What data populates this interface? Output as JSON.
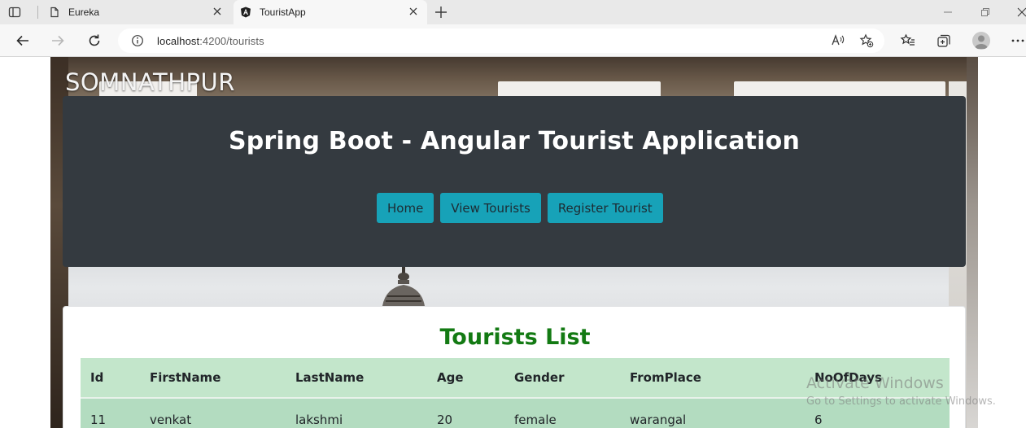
{
  "browser": {
    "tabs": [
      {
        "title": "Eureka",
        "active": false
      },
      {
        "title": "TouristApp",
        "active": true
      }
    ],
    "address": {
      "host": "localhost",
      "rest": ":4200/tourists"
    }
  },
  "page": {
    "background_caption": "SOMNATHPUR",
    "header_title": "Spring Boot - Angular Tourist Application",
    "nav_buttons": [
      "Home",
      "View Tourists",
      "Register Tourist"
    ],
    "accent_color": "#17a2b8",
    "list_title": "Tourists List",
    "list_title_color": "#137a13",
    "table": {
      "columns": [
        "Id",
        "FirstName",
        "LastName",
        "Age",
        "Gender",
        "FromPlace",
        "NoOfDays"
      ],
      "rows": [
        [
          "11",
          "venkat",
          "lakshmi",
          "20",
          "female",
          "warangal",
          "6"
        ]
      ]
    }
  },
  "watermark": {
    "line1": "Activate Windows",
    "line2": "Go to Settings to activate Windows."
  }
}
